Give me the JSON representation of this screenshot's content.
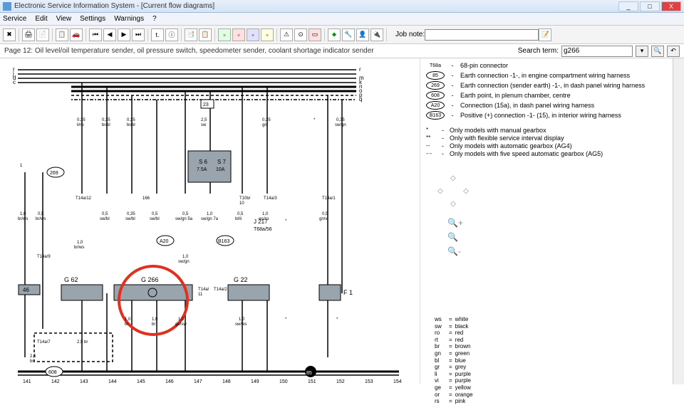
{
  "window": {
    "title": "Electronic Service Information System - [Current flow diagrams]",
    "min": "_",
    "max": "□",
    "close": "X"
  },
  "menu": {
    "service": "Service",
    "edit": "Edit",
    "view": "View",
    "settings": "Settings",
    "warnings": "Warnings",
    "help": "?"
  },
  "toolbar": {
    "job_note_label": "Job note:",
    "job_note_value": ""
  },
  "header": {
    "page_title": "Page 12: Oil level/oil temperature sender, oil pressure switch, speedometer sender, coolant shortage indicator sender",
    "search_label": "Search term:",
    "search_value": "g266"
  },
  "connectors": [
    {
      "sym": "T68a",
      "shape": "text",
      "desc": "68-pin connector"
    },
    {
      "sym": "85",
      "shape": "oval",
      "desc": "Earth connection -1-, in engine compartment wiring harness"
    },
    {
      "sym": "269",
      "shape": "oval",
      "desc": "Earth connection (sender earth) -1-, in dash panel wiring harness"
    },
    {
      "sym": "608",
      "shape": "oval",
      "desc": "Earth point, in plenum chamber, centre"
    },
    {
      "sym": "A20",
      "shape": "oval",
      "desc": "Connection (15a), in dash panel wiring harness"
    },
    {
      "sym": "B163",
      "shape": "oval",
      "desc": "Positive (+) connection -1- (15), in interior wiring harness"
    }
  ],
  "notes": [
    {
      "sym": "*",
      "desc": "Only models with manual gearbox"
    },
    {
      "sym": "**",
      "desc": "Only with flexible service interval display"
    },
    {
      "sym": "--",
      "desc": "Only models with automatic gearbox (AG4)"
    },
    {
      "sym": "-·-",
      "desc": "Only models with five speed automatic gearbox (AG5)"
    }
  ],
  "colors": [
    {
      "code": "ws",
      "name": "white"
    },
    {
      "code": "sw",
      "name": "black"
    },
    {
      "code": "ro",
      "name": "red"
    },
    {
      "code": "rt",
      "name": "red"
    },
    {
      "code": "br",
      "name": "brown"
    },
    {
      "code": "gn",
      "name": "green"
    },
    {
      "code": "bl",
      "name": "blue"
    },
    {
      "code": "gr",
      "name": "grey"
    },
    {
      "code": "li",
      "name": "purple"
    },
    {
      "code": "vi",
      "name": "purple"
    },
    {
      "code": "ge",
      "name": "yellow"
    },
    {
      "code": "or",
      "name": "orange"
    },
    {
      "code": "rs",
      "name": "pink"
    }
  ],
  "chart_data": {
    "type": "diagram",
    "title": "Current flow diagram - Page 12",
    "highlighted_component": "G266",
    "components": [
      "G62",
      "G266",
      "G22",
      "F1",
      "J217"
    ],
    "fuses": [
      "S6 7.5A",
      "S7 10A"
    ],
    "terminals": [
      "T14a/12",
      "T14a/9",
      "T14a/7",
      "T14a/11",
      "T14a/2",
      "T14a/3",
      "T14a/1",
      "T10b/10",
      "T68a/56"
    ],
    "earth_points": [
      "46",
      "85",
      "269",
      "608"
    ],
    "side_labels_left": [
      "r",
      "j",
      "d",
      "c"
    ],
    "side_labels_right": [
      "r",
      "m",
      "k",
      "n",
      "o",
      "p",
      "q"
    ],
    "wire_specs": [
      "0.35 li/ro",
      "0.35 br/bl",
      "0.35 br/bl",
      "2.5 sw",
      "0.35 gn",
      "0.35 sw/gn",
      "0.5 gn/vi",
      "1.0 br/ws",
      "0.5 br/ws",
      "0.5 sw/bl",
      "0.35 sw/bl",
      "0.5 sw/bl",
      "0.5 sw/gn 5a",
      "1.0 sw/gn 7a",
      "0.5 bl/li",
      "1.0 ws/ro",
      "1.0 br/ws",
      "2.5 br",
      "2.5 br",
      "1.0 br",
      "1.0 br",
      "1.0 ge/sw",
      "1.0 sw/ws"
    ],
    "x_axis_positions": [
      141,
      142,
      143,
      144,
      145,
      146,
      147,
      148,
      149,
      150,
      151,
      152,
      153,
      154
    ],
    "circled_ref": "G266"
  }
}
